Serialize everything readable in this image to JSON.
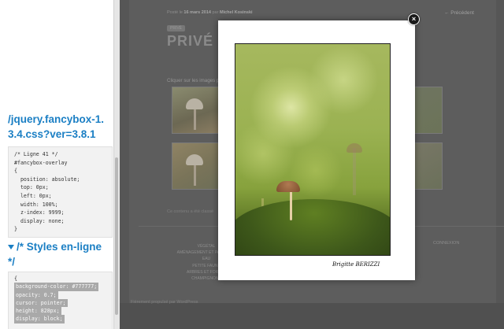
{
  "devtools": {
    "file_link": "/jquery.fancybox-1.3.4.css?ver=3.8.1",
    "rule_lines": [
      "/* Ligne 41 */",
      "#fancybox-overlay",
      "{",
      "  position: absolute;",
      "  top: 0px;",
      "  left: 0px;",
      "  width: 100%;",
      "  z-index: 9999;",
      "  display: none;",
      "}"
    ],
    "inline_heading": "/* Styles en-ligne */",
    "inline_open": "{",
    "inline_lines": [
      "background-color: #777777;",
      "opacity: 0.7;",
      "cursor: pointer;",
      "height: 828px;",
      "display: block;"
    ]
  },
  "site": {
    "meta_prefix": "Posté le",
    "meta_date": "16 mars 2014",
    "meta_by": "par",
    "meta_author": "Michel Kosinski",
    "prev_link": "← Précédent",
    "category": "PRIVÉ",
    "title": "PRIVÉ :",
    "intro": "Cliquer sur les images p",
    "comments": "Ce contenu a été classé",
    "footer_items": [
      "VÉGÉTAL",
      "AMÉNAGEMENT ET PAYSAGES",
      "EAU",
      "PETITE FAUNE",
      "ARBRES ET FORÊTS",
      "CHAMPIGNONS"
    ],
    "footer_right": "CONNEXION",
    "powered": "Fièrement propulsé par WordPress"
  },
  "lightbox": {
    "signature": "Brigitte BERIZZI",
    "close_glyph": "×"
  },
  "colors": {
    "link_blue": "#1b7fc4",
    "overlay": "#777777"
  }
}
